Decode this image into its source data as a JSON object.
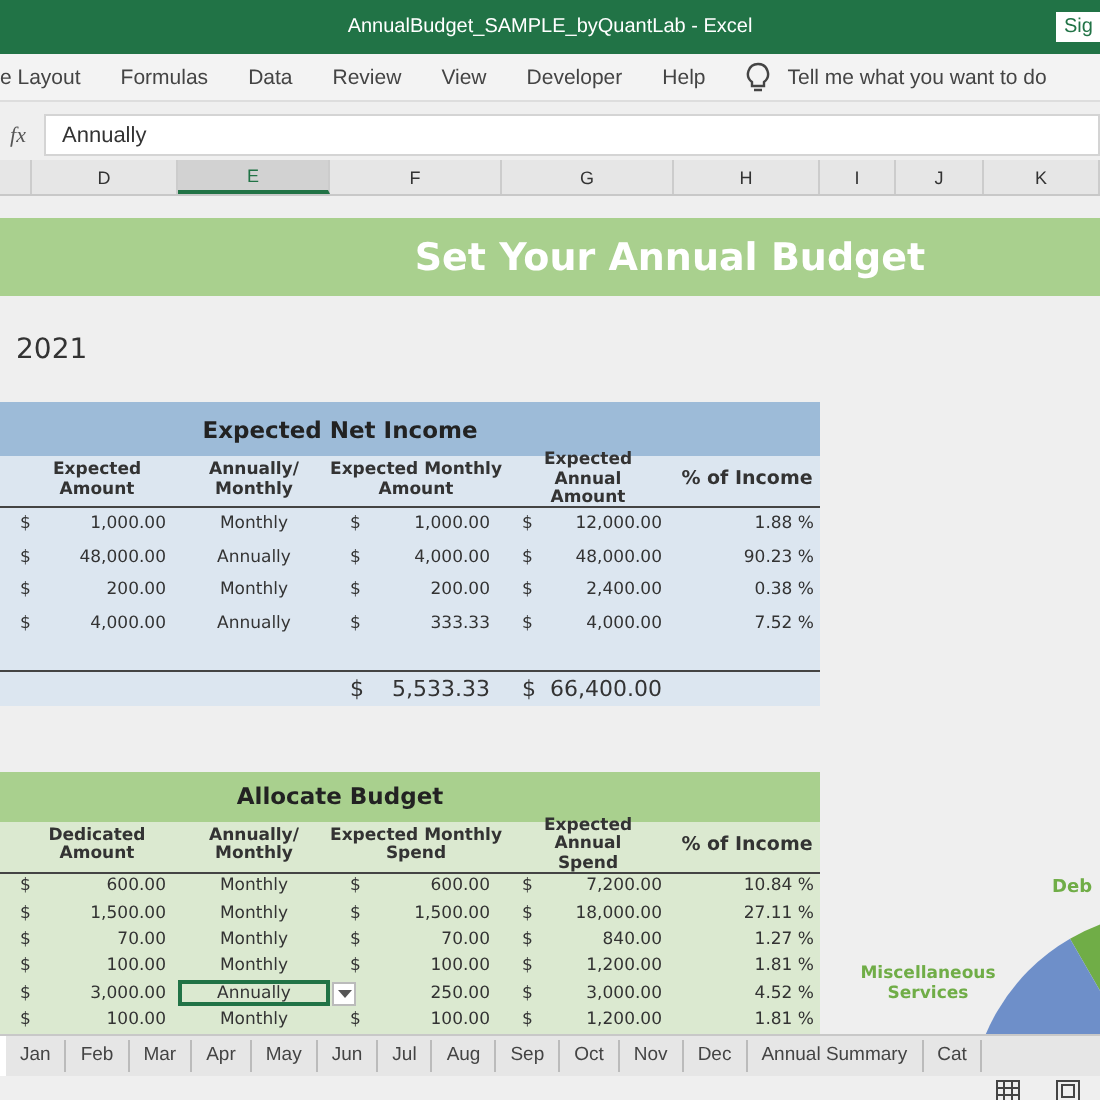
{
  "window": {
    "title": "AnnualBudget_SAMPLE_byQuantLab  -  Excel",
    "account_button": "Sig"
  },
  "ribbon": {
    "tabs": [
      "e Layout",
      "Formulas",
      "Data",
      "Review",
      "View",
      "Developer",
      "Help"
    ],
    "tell_me": "Tell me what you want to do"
  },
  "formula_bar": {
    "fx": "fx",
    "value": "Annually"
  },
  "columns": [
    {
      "label": "D",
      "selected": false
    },
    {
      "label": "E",
      "selected": true
    },
    {
      "label": "F",
      "selected": false
    },
    {
      "label": "G",
      "selected": false
    },
    {
      "label": "H",
      "selected": false
    },
    {
      "label": "I",
      "selected": false
    },
    {
      "label": "J",
      "selected": false
    },
    {
      "label": "K",
      "selected": false
    }
  ],
  "sheet": {
    "banner": "Set Your Annual Budget",
    "year": "2021",
    "income": {
      "title": "Expected Net Income",
      "headers": [
        "Expected Amount",
        "Annually/ Monthly",
        "Expected Monthly Amount",
        "Expected Annual Amount",
        "% of Income"
      ],
      "rows": [
        {
          "cur1": "$",
          "amount": "1,000.00",
          "freq": "Monthly",
          "cur2": "$",
          "monthly": "1,000.00",
          "cur3": "$",
          "annual": "12,000.00",
          "pct": "1.88 %",
          "selected": false
        },
        {
          "cur1": "$",
          "amount": "48,000.00",
          "freq": "Annually",
          "cur2": "$",
          "monthly": "4,000.00",
          "cur3": "$",
          "annual": "48,000.00",
          "pct": "90.23 %",
          "selected": false
        },
        {
          "cur1": "$",
          "amount": "200.00",
          "freq": "Monthly",
          "cur2": "$",
          "monthly": "200.00",
          "cur3": "$",
          "annual": "2,400.00",
          "pct": "0.38 %",
          "selected": false
        },
        {
          "cur1": "$",
          "amount": "4,000.00",
          "freq": "Annually",
          "cur2": "$",
          "monthly": "333.33",
          "cur3": "$",
          "annual": "4,000.00",
          "pct": "7.52 %",
          "selected": false
        }
      ],
      "total": {
        "cur2": "$",
        "monthly": "5,533.33",
        "cur3": "$",
        "annual": "66,400.00"
      }
    },
    "allocate": {
      "title": "Allocate Budget",
      "headers": [
        "Dedicated Amount",
        "Annually/ Monthly",
        "Expected Monthly Spend",
        "Expected Annual Spend",
        "% of Income"
      ],
      "rows": [
        {
          "cur1": "$",
          "amount": "600.00",
          "freq": "Monthly",
          "cur2": "$",
          "monthly": "600.00",
          "cur3": "$",
          "annual": "7,200.00",
          "pct": "10.84 %",
          "selected": false
        },
        {
          "cur1": "$",
          "amount": "1,500.00",
          "freq": "Monthly",
          "cur2": "$",
          "monthly": "1,500.00",
          "cur3": "$",
          "annual": "18,000.00",
          "pct": "27.11 %",
          "selected": false
        },
        {
          "cur1": "$",
          "amount": "70.00",
          "freq": "Monthly",
          "cur2": "$",
          "monthly": "70.00",
          "cur3": "$",
          "annual": "840.00",
          "pct": "1.27 %",
          "selected": false
        },
        {
          "cur1": "$",
          "amount": "100.00",
          "freq": "Monthly",
          "cur2": "$",
          "monthly": "100.00",
          "cur3": "$",
          "annual": "1,200.00",
          "pct": "1.81 %",
          "selected": false
        },
        {
          "cur1": "$",
          "amount": "3,000.00",
          "freq": "Annually",
          "monthly": "250.00",
          "cur3": "$",
          "annual": "3,000.00",
          "pct": "4.52 %",
          "selected": true
        },
        {
          "cur1": "$",
          "amount": "100.00",
          "freq": "Monthly",
          "cur2": "$",
          "monthly": "100.00",
          "cur3": "$",
          "annual": "1,200.00",
          "pct": "1.81 %",
          "selected": false
        }
      ]
    },
    "pie_labels": [
      "Deb",
      "Miscellaneous Services"
    ]
  },
  "sheet_tabs": [
    {
      "label": "Jan",
      "selected": false
    },
    {
      "label": "Feb",
      "selected": false
    },
    {
      "label": "Mar",
      "selected": false
    },
    {
      "label": "Apr",
      "selected": false
    },
    {
      "label": "May",
      "selected": false
    },
    {
      "label": "Jun",
      "selected": false
    },
    {
      "label": "Jul",
      "selected": false
    },
    {
      "label": "Aug",
      "selected": false
    },
    {
      "label": "Sep",
      "selected": false
    },
    {
      "label": "Oct",
      "selected": false
    },
    {
      "label": "Nov",
      "selected": false
    },
    {
      "label": "Dec",
      "selected": false
    },
    {
      "label": "Annual Summary",
      "selected": false
    },
    {
      "label": "Cat",
      "selected": false
    }
  ]
}
